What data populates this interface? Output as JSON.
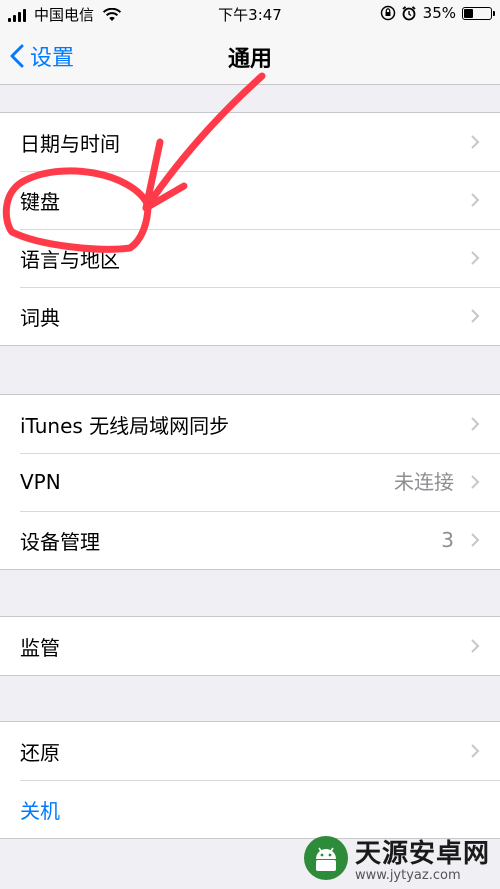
{
  "status_bar": {
    "carrier": "中国电信",
    "time": "下午3:47",
    "battery": "35%",
    "battery_level": 0.35
  },
  "nav": {
    "back_label": "设置",
    "title": "通用"
  },
  "groups": [
    {
      "rows": [
        {
          "label": "日期与时间"
        },
        {
          "label": "键盘"
        },
        {
          "label": "语言与地区"
        },
        {
          "label": "词典"
        }
      ]
    },
    {
      "rows": [
        {
          "label": "iTunes 无线局域网同步"
        },
        {
          "label": "VPN",
          "value": "未连接"
        },
        {
          "label": "设备管理",
          "value": "3"
        }
      ]
    },
    {
      "rows": [
        {
          "label": "监管"
        }
      ]
    },
    {
      "rows": [
        {
          "label": "还原"
        },
        {
          "label": "关机",
          "style": "blue"
        }
      ]
    }
  ],
  "watermark": {
    "name": "天源安卓网",
    "url": "www.jytyaz.com"
  },
  "colors": {
    "accent": "#007aff",
    "annotation": "#ff3b4a"
  }
}
